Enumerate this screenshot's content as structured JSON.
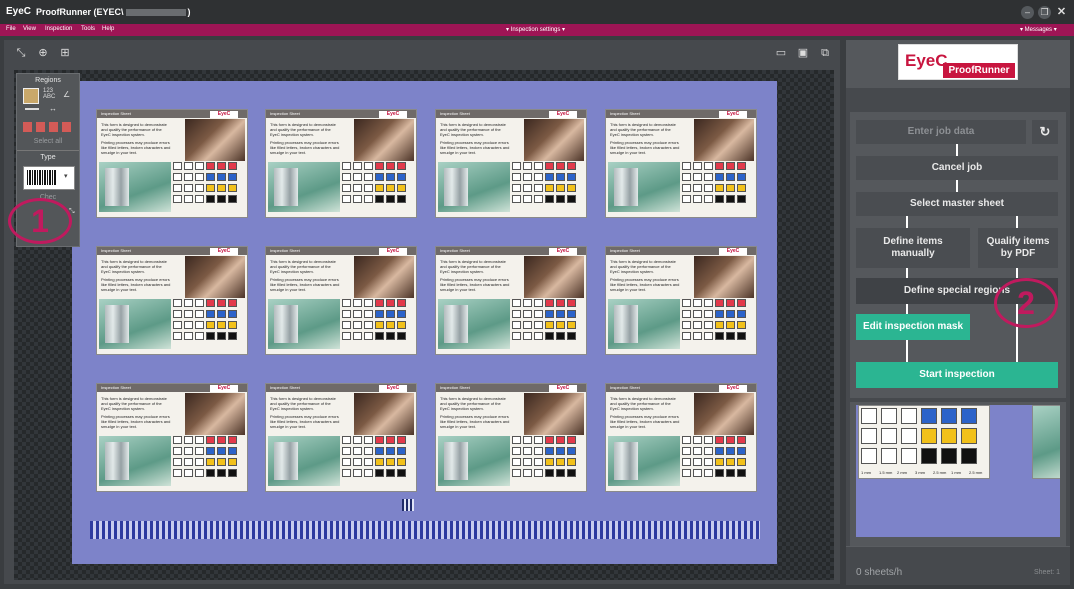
{
  "titlebar": {
    "logo": "EyeC",
    "title": "ProofRunner  (EYEC\\",
    "title_tail": ")",
    "min_icon": "minimize-icon",
    "max_icon": "restore-icon",
    "close_icon": "close-icon"
  },
  "menubar": {
    "items": [
      "File",
      "View",
      "Inspection",
      "Tools",
      "Help"
    ],
    "center": "▾ Inspection settings ▾",
    "right": "▾ Messages ▾"
  },
  "toolbar": {
    "fit": "⤡",
    "zoom_in": "⊕",
    "zoom_sel": "⊞",
    "open": "📂",
    "save": "💾",
    "export": "⎘"
  },
  "regions_panel": {
    "title": "Regions",
    "select_all": "Select all",
    "type_title": "Type",
    "check": "Chec"
  },
  "card": {
    "band_text": "Inspection Sheet",
    "logo": "EyeC",
    "body1": "This form is designed to demonstrate and qualify the performance of the EyeC inspection system.",
    "body2": "Printing processes may produce errors like filled letters, broken characters and smudge in your text."
  },
  "workflow": {
    "enter_job": "Enter job data",
    "refresh_icon": "refresh-icon",
    "cancel_job": "Cancel job",
    "select_master": "Select master sheet",
    "define_manual": "Define items\nmanually",
    "qualify_pdf": "Qualify items\nby PDF",
    "define_special": "Define special regions",
    "edit_mask": "Edit inspection mask",
    "start": "Start inspection"
  },
  "preview": {
    "scale_labels": [
      "1 mm",
      "1.5 mm",
      "2 mm",
      "3 mm",
      "2.5 mm",
      "1 mm",
      "2.5 mm"
    ]
  },
  "status": {
    "rate": "0 sheets/h",
    "sheet": "Sheet: 1"
  },
  "annotations": {
    "one": "1",
    "two": "2"
  },
  "colors": {
    "brand": "#c8153f",
    "menubar": "#9e1555",
    "sheet": "#7d83c9",
    "green": "#2bb592",
    "annotation": "#c01a5e"
  }
}
